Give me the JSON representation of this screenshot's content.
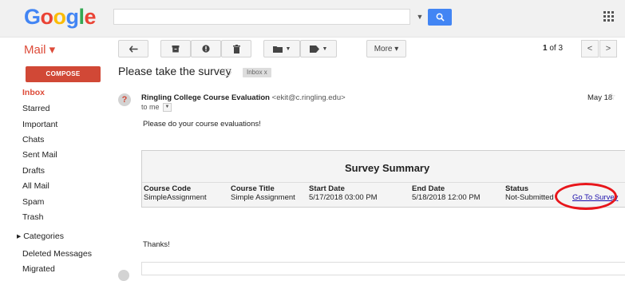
{
  "header": {
    "logo": "Google",
    "search": {
      "value": "",
      "placeholder": ""
    },
    "brand_colors": [
      "#4285f4",
      "#ea4335",
      "#fbbc05",
      "#34a853"
    ]
  },
  "mail": {
    "label": "Mail ▾",
    "toolbar": {
      "more_label": "More ▾"
    },
    "pager": {
      "range": "1",
      "total_text": "of 3"
    }
  },
  "sidebar": {
    "compose_label": "COMPOSE",
    "items": [
      {
        "label": "Inbox",
        "active": true
      },
      {
        "label": "Starred"
      },
      {
        "label": "Important"
      },
      {
        "label": "Chats"
      },
      {
        "label": "Sent Mail"
      },
      {
        "label": "Drafts"
      },
      {
        "label": "All Mail"
      },
      {
        "label": "Spam"
      },
      {
        "label": "Trash"
      },
      {
        "label": "▸ Categories"
      },
      {
        "label": "Deleted Messages"
      },
      {
        "label": "Migrated"
      }
    ]
  },
  "email": {
    "subject": "Please take the survey",
    "label_chip": "Inbox  x",
    "sender_name": "Ringling College Course Evaluation",
    "sender_email": "<ekit@c.ringling.edu>",
    "to": "to me",
    "date": "May 18",
    "body": "Please do your course evaluations!",
    "thanks": "Thanks!",
    "survey": {
      "title": "Survey Summary",
      "columns": [
        "Course Code",
        "Course Title",
        "Start Date",
        "End Date",
        "Status"
      ],
      "row": {
        "code": "SimpleAssignment",
        "title": "Simple Assignment",
        "start": "5/17/2018 03:00 PM",
        "end": "5/18/2018 12:00 PM",
        "status": "Not-Submitted",
        "link": "Go To Survey"
      }
    }
  }
}
